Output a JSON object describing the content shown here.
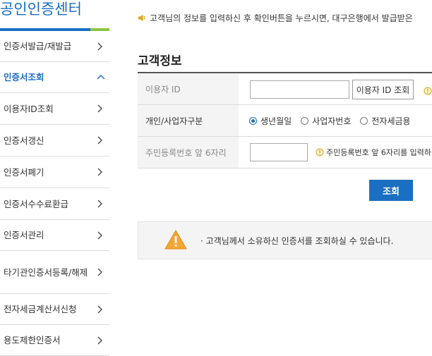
{
  "sidebar": {
    "title": "공인인증센터",
    "items": [
      {
        "label": "인증서발급/재발급",
        "active": false,
        "chevron": "chevron-right"
      },
      {
        "label": "인증서조회",
        "active": true,
        "chevron": "chevron-up"
      },
      {
        "label": "이용자ID조회",
        "active": false,
        "chevron": "chevron-right"
      },
      {
        "label": "인증서갱신",
        "active": false,
        "chevron": "chevron-right"
      },
      {
        "label": "인증서폐기",
        "active": false,
        "chevron": "chevron-right"
      },
      {
        "label": "인증서수수료환급",
        "active": false,
        "chevron": "chevron-right"
      },
      {
        "label": "인증서관리",
        "active": false,
        "chevron": "chevron-right"
      },
      {
        "label": "타기관인증서등록/해제",
        "active": false,
        "chevron": "chevron-right"
      },
      {
        "label": "전자세금계산서신청",
        "active": false,
        "chevron": "chevron-right"
      },
      {
        "label": "용도제한인증서",
        "active": false,
        "chevron": "chevron-right"
      }
    ]
  },
  "notice": {
    "icon": "speaker-icon",
    "text": "고객님의 정보를 입력하신 후 확인버튼을 누르시면, 대구은행에서 발급받은"
  },
  "section_title": "고객정보",
  "form": {
    "user_id": {
      "label": "이용자 ID",
      "value": "",
      "lookup_button": "이용자 ID 조회"
    },
    "type": {
      "label": "개인/사업자구분",
      "options": [
        {
          "label": "생년월일",
          "checked": true
        },
        {
          "label": "사업자번호",
          "checked": false
        },
        {
          "label": "전자세금용",
          "checked": false
        }
      ]
    },
    "resident": {
      "label": "주민등록번호 앞 6자리",
      "value": "",
      "hint": "주민등록번호 앞 6자리를 입력하"
    }
  },
  "submit_label": "조회",
  "info_box": {
    "icon": "warning-icon",
    "message": "· 고객님께서 소유하신 인증서를 조회하실 수 있습니다."
  },
  "colors": {
    "accent": "#1a6fc1",
    "accent_green": "#8cc63f",
    "warning": "#f0a030"
  }
}
